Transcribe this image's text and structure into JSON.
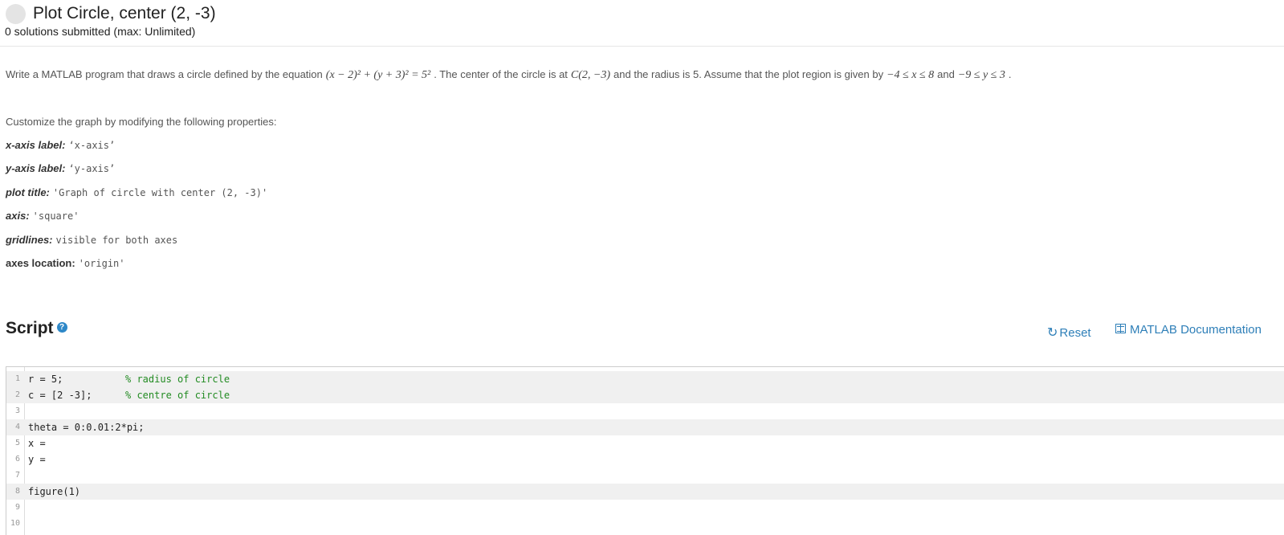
{
  "header": {
    "title": "Plot Circle, center (2, -3)",
    "submitted": "0 solutions submitted (max: Unlimited)"
  },
  "description": {
    "t1": "Write a MATLAB program that draws a circle defined by the equation",
    "eq": "(x − 2)² + (y + 3)² = 5²",
    "t2": ". The center of the circle is at",
    "center": "C(2, −3)",
    "t3": "and the radius is 5. Assume that the plot region is given by",
    "xrange": "−4 ≤ x ≤ 8",
    "t4": "and",
    "yrange": "−9 ≤ y ≤ 3",
    "t5": "."
  },
  "customize_text": "Customize the graph by modifying the following properties:",
  "properties": [
    {
      "label": "x-axis label:",
      "value": "‘x-axis’"
    },
    {
      "label": "y-axis label:",
      "value": "‘y-axis’"
    },
    {
      "label": "plot title:",
      "value": "'Graph of circle with center (2, -3)'"
    },
    {
      "label": "axis:",
      "value": "'square'"
    },
    {
      "label": "gridlines:",
      "value": "visible for both axes"
    },
    {
      "label": "axes location:",
      "value": "'origin'"
    }
  ],
  "script": {
    "heading": "Script",
    "help_icon": "question-circle-icon",
    "reset_label": "Reset",
    "reset_icon": "refresh-icon",
    "doc_label": "MATLAB Documentation",
    "doc_icon": "book-icon"
  },
  "code_lines": [
    {
      "num": "1",
      "code": "r = 5;",
      "comment": "% radius of circle",
      "shaded": true
    },
    {
      "num": "2",
      "code": "c = [2 -3];",
      "comment": "% centre of circle",
      "shaded": true
    },
    {
      "num": "3",
      "code": "",
      "comment": "",
      "shaded": false
    },
    {
      "num": "4",
      "code": "theta = 0:0.01:2*pi;",
      "comment": "",
      "shaded": true
    },
    {
      "num": "5",
      "code": "x =",
      "comment": "",
      "shaded": false
    },
    {
      "num": "6",
      "code": "y =",
      "comment": "",
      "shaded": false
    },
    {
      "num": "7",
      "code": "",
      "comment": "",
      "shaded": false
    },
    {
      "num": "8",
      "code": "figure(1)",
      "comment": "",
      "shaded": true
    },
    {
      "num": "9",
      "code": "",
      "comment": "",
      "shaded": false
    },
    {
      "num": "10",
      "code": "",
      "comment": "",
      "shaded": false
    }
  ],
  "colors": {
    "link": "#2e7fb8",
    "comment": "#228b22",
    "help_badge": "#2e88c8"
  }
}
